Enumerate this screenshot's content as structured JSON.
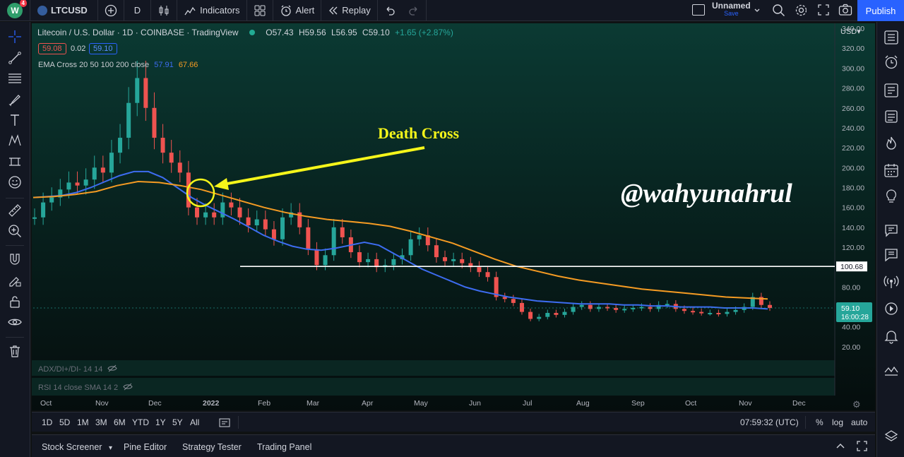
{
  "topbar": {
    "avatar_letter": "W",
    "avatar_badge": "4",
    "symbol": "LTCUSD",
    "interval": "D",
    "indicators_label": "Indicators",
    "alert_label": "Alert",
    "replay_label": "Replay",
    "layout_name": "Unnamed",
    "layout_status": "Save",
    "publish_label": "Publish"
  },
  "legend": {
    "title": "Litecoin / U.S. Dollar · 1D · COINBASE · TradingView",
    "o": "O57.43",
    "h": "H59.56",
    "l": "L56.95",
    "c": "C59.10",
    "chg": "+1.65 (+2.87%)",
    "bid": "59.08",
    "spread": "0.02",
    "ask": "59.10",
    "ema_label": "EMA Cross 20 50 100 200 close",
    "ema_fast": "57.91",
    "ema_slow": "67.66",
    "adx_label": "ADX/DI+/DI- 14 14",
    "rsi_label": "RSI 14 close SMA 14 2"
  },
  "annotations": {
    "death_cross": "Death Cross",
    "watermark": "@wahyunahrul"
  },
  "price_scale": {
    "currency": "USD",
    "hline_label": "100.68",
    "last_price": "59.10",
    "countdown": "16:00:28"
  },
  "colors": {
    "ema_fast": "#3d6cf0",
    "ema_slow": "#f59b23",
    "annotation": "#f5f51a",
    "bull": "#26a69a",
    "bear": "#ef5350",
    "hline": "#ffffff",
    "publish": "#2962ff"
  },
  "timeframes": [
    "1D",
    "5D",
    "1M",
    "3M",
    "6M",
    "YTD",
    "1Y",
    "5Y",
    "All"
  ],
  "bottombar": {
    "clock": "07:59:32 (UTC)",
    "percent": "%",
    "log": "log",
    "auto": "auto"
  },
  "panels": [
    "Stock Screener",
    "Pine Editor",
    "Strategy Tester",
    "Trading Panel"
  ],
  "chart_data": {
    "type": "line",
    "title": "Litecoin / U.S. Dollar · 1D · COINBASE · TradingView",
    "x_ticks": [
      "Oct",
      "Nov",
      "Dec",
      "2022",
      "Feb",
      "Mar",
      "Apr",
      "May",
      "Jun",
      "Jul",
      "Aug",
      "Sep",
      "Oct",
      "Nov",
      "Dec"
    ],
    "y_ticks": [
      20,
      40,
      60,
      80,
      100,
      120,
      140,
      160,
      180,
      200,
      220,
      240,
      260,
      280,
      300,
      320,
      340
    ],
    "ylim": [
      10,
      345
    ],
    "grid": false,
    "series": [
      {
        "name": "Litecoin / U.S. Dollar",
        "style": "candles-approx",
        "values": [
          150,
          165,
          170,
          178,
          185,
          182,
          188,
          200,
          195,
          215,
          230,
          265,
          290,
          260,
          230,
          215,
          205,
          195,
          160,
          150,
          155,
          150,
          165,
          160,
          150,
          142,
          148,
          138,
          128,
          150,
          155,
          140,
          118,
          102,
          112,
          140,
          130,
          115,
          105,
          108,
          100,
          102,
          108,
          112,
          128,
          132,
          122,
          110,
          106,
          108,
          104,
          100,
          95,
          90,
          70,
          68,
          64,
          55,
          48,
          50,
          54,
          52,
          55,
          60,
          62,
          58,
          60,
          59,
          57,
          58,
          59,
          60,
          58,
          62,
          63,
          58,
          56,
          55,
          54,
          54,
          53,
          55,
          57,
          60,
          70,
          62,
          59
        ]
      },
      {
        "name": "EMA 20",
        "values": [
          170,
          171,
          172,
          175,
          180,
          186,
          192,
          196,
          196,
          190,
          180,
          170,
          162,
          155,
          148,
          140,
          132,
          126,
          121,
          118,
          117,
          119,
          122,
          125,
          122,
          114,
          106,
          98,
          92,
          86,
          80,
          76,
          73,
          70,
          68,
          66,
          65,
          64,
          63,
          63,
          63,
          62,
          62,
          61,
          61,
          60,
          60,
          60,
          59,
          59,
          59,
          58
        ]
      },
      {
        "name": "EMA 200",
        "values": [
          170,
          171,
          173,
          176,
          182,
          186,
          185,
          182,
          178,
          172,
          166,
          160,
          155,
          151,
          148,
          146,
          144,
          141,
          136,
          130,
          124,
          116,
          108,
          101,
          96,
          91,
          87,
          84,
          81,
          78,
          76,
          74,
          72,
          70,
          69,
          68
        ]
      }
    ],
    "hlines": [
      100.68
    ],
    "annotations": [
      "Death Cross",
      "@wahyunahrul"
    ]
  }
}
